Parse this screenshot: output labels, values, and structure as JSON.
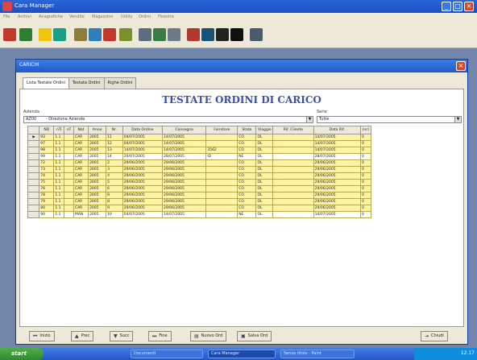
{
  "app": {
    "title": "Cara Manager"
  },
  "menu": [
    "File",
    "Archivi",
    "Anagrafiche",
    "Vendite",
    "Magazzino",
    "Utility",
    "Ordini",
    "Finestra"
  ],
  "window": {
    "title": "CARICHI"
  },
  "tabs": [
    "Lista Testate Ordini",
    "Testata Ordini",
    "Righe Ordini"
  ],
  "heading": "TESTATE ORDINI DI CARICO",
  "azienda": {
    "label": "Azienda",
    "code": "AZ00",
    "value": "- Direzione Aziende"
  },
  "serie": {
    "label": "Serie",
    "value": "Tutte"
  },
  "grid": {
    "columns": [
      "ND",
      "nTi",
      "nT",
      "Nat",
      "Anno",
      "Nr.",
      "Data Ordine",
      "Consegna",
      "Fornitore",
      "Stato",
      "Viaggio",
      "Rif. Cliente",
      "Data Rif.",
      "Incl"
    ],
    "rows": [
      {
        "highlight": "yellow",
        "cells": [
          "93",
          "1.1",
          "CAR",
          "2005",
          "11",
          "04/07/2005",
          "14/07/2005",
          "",
          "CO",
          "OL",
          "",
          "14/07/2005",
          "0"
        ]
      },
      {
        "highlight": "yellow",
        "cells": [
          "97",
          "1.1",
          "CAR",
          "2005",
          "12",
          "04/07/2005",
          "14/07/2005",
          "",
          "CO",
          "OL",
          "",
          "14/07/2005",
          "0"
        ]
      },
      {
        "highlight": "yellow",
        "cells": [
          "98",
          "1.1",
          "CAR",
          "2005",
          "13",
          "14/07/2005",
          "14/07/2005",
          "3562",
          "CO",
          "OL",
          "",
          "14/07/2005",
          "0"
        ]
      },
      {
        "highlight": "white",
        "cells": [
          "99",
          "1.1",
          "CAR",
          "2005",
          "14",
          "20/07/2005",
          "28/07/2005",
          "ID",
          "NE",
          "OL",
          "",
          "28/07/2005",
          "0"
        ]
      },
      {
        "highlight": "yellow",
        "cells": [
          "72",
          "1.1",
          "CAR",
          "2005",
          "2",
          "29/06/2005",
          "29/06/2005",
          "",
          "CO",
          "OL",
          "",
          "29/06/2005",
          "0"
        ]
      },
      {
        "highlight": "yellow",
        "cells": [
          "73",
          "1.1",
          "CAR",
          "2005",
          "3",
          "29/06/2005",
          "29/06/2005",
          "",
          "CO",
          "OL",
          "",
          "29/06/2005",
          "0"
        ]
      },
      {
        "highlight": "yellow",
        "cells": [
          "74",
          "1.1",
          "CAR",
          "2005",
          "4",
          "29/06/2005",
          "29/06/2005",
          "",
          "CO",
          "OL",
          "",
          "29/06/2005",
          "0"
        ]
      },
      {
        "highlight": "yellow",
        "cells": [
          "75",
          "1.1",
          "CAR",
          "2005",
          "5",
          "29/06/2005",
          "29/06/2005",
          "",
          "CO",
          "OL",
          "",
          "29/06/2005",
          "0"
        ]
      },
      {
        "highlight": "yellow",
        "cells": [
          "76",
          "1.1",
          "CAR",
          "2005",
          "6",
          "29/06/2005",
          "29/06/2005",
          "",
          "CO",
          "OL",
          "",
          "29/06/2005",
          "0"
        ]
      },
      {
        "highlight": "yellow",
        "cells": [
          "78",
          "1.1",
          "CAR",
          "2005",
          "8",
          "29/06/2005",
          "29/06/2005",
          "",
          "CO",
          "OL",
          "",
          "29/06/2005",
          "0"
        ]
      },
      {
        "highlight": "yellow",
        "cells": [
          "79",
          "1.1",
          "CAR",
          "2005",
          "8",
          "29/06/2005",
          "29/06/2005",
          "",
          "CO",
          "OL",
          "",
          "29/06/2005",
          "0"
        ]
      },
      {
        "highlight": "yellow",
        "cells": [
          "80",
          "1.1",
          "CAR",
          "2005",
          "9",
          "29/06/2005",
          "29/06/2005",
          "",
          "CO",
          "OL",
          "",
          "29/06/2005",
          "0"
        ]
      },
      {
        "highlight": "white",
        "cells": [
          "90",
          "1.1",
          "MAN",
          "2005",
          "10",
          "04/07/2005",
          "14/07/2005",
          "",
          "NE",
          "OL",
          "",
          "14/07/2005",
          "0"
        ]
      }
    ]
  },
  "buttons": {
    "first": "Inizio",
    "prev": "Prec",
    "next": "Succ",
    "last": "Fine",
    "new": "Nuovo Ord",
    "save": "Salva Ord",
    "exit": "Chiudi"
  },
  "taskbar": {
    "start": "start",
    "items": [
      "Documenti",
      "Cara Manager",
      "Senza titolo - Paint"
    ],
    "clock": "12.17"
  },
  "colors": {
    "titlebar": "#2458c8",
    "heading": "#3a4fb0",
    "row_highlight": "#fff3a6",
    "row_plain": "#ffffff",
    "start_button": "#2f8b2e"
  },
  "icons": {
    "window_close": "close-icon",
    "dropdown": "chevron-down-icon",
    "row_selector": "row-pointer-icon"
  }
}
